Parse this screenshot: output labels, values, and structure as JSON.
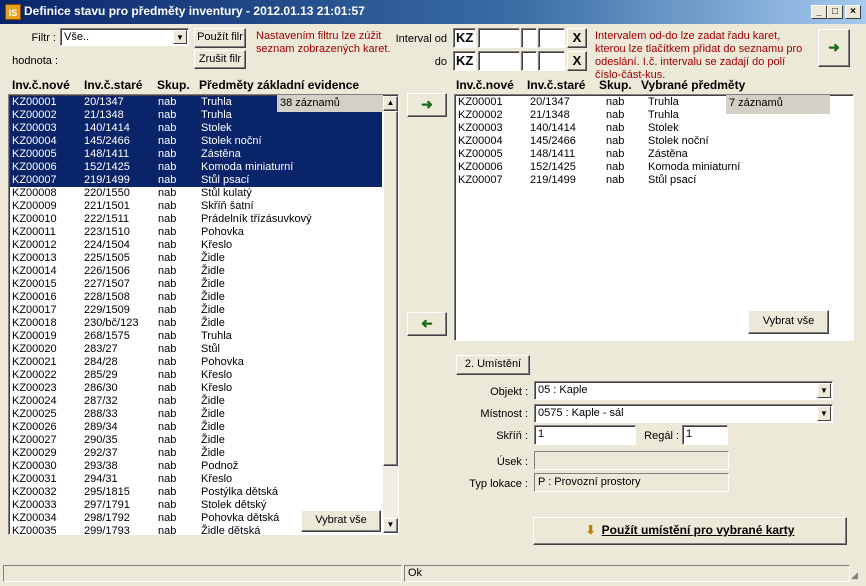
{
  "window": {
    "title": "Definice stavu pro předměty inventury - 2012.01.13 21:01:57",
    "app_icon": "IS"
  },
  "filter": {
    "filter_label": "Filtr :",
    "filter_value": "Vše..",
    "hodnota_label": "hodnota :",
    "apply_label": "Použít filr",
    "cancel_label": "Zrušit filr",
    "note": "Nastavením filtru lze zúžit seznam zobrazených karet."
  },
  "interval": {
    "from_label": "Interval od",
    "to_label": "do",
    "prefix_from": "KZ",
    "prefix_to": "KZ",
    "clear_symbol": "X",
    "note": "Intervalem od-do lze zadat řadu karet, kterou lze tlačítkem přidat do seznamu pro odeslání. I.č. intervalu se zadají do polí číslo-část-kus."
  },
  "left_list": {
    "headers": [
      "Inv.č.nové",
      "Inv.č.staré",
      "Skup.",
      "Předměty základní evidence"
    ],
    "count_label": "38 záznamů",
    "select_all_label": "Vybrat vše",
    "rows": [
      {
        "new": "KZ00001",
        "old": "20/1347",
        "grp": "nab",
        "name": "Truhla",
        "sel": true
      },
      {
        "new": "KZ00002",
        "old": "21/1348",
        "grp": "nab",
        "name": "Truhla",
        "sel": true
      },
      {
        "new": "KZ00003",
        "old": "140/1414",
        "grp": "nab",
        "name": "Stolek",
        "sel": true
      },
      {
        "new": "KZ00004",
        "old": "145/2466",
        "grp": "nab",
        "name": "Stolek noční",
        "sel": true
      },
      {
        "new": "KZ00005",
        "old": "148/1411",
        "grp": "nab",
        "name": "Zástěna",
        "sel": true
      },
      {
        "new": "KZ00006",
        "old": "152/1425",
        "grp": "nab",
        "name": "Komoda miniaturní",
        "sel": true
      },
      {
        "new": "KZ00007",
        "old": "219/1499",
        "grp": "nab",
        "name": "Stůl psací",
        "sel": true
      },
      {
        "new": "KZ00008",
        "old": "220/1550",
        "grp": "nab",
        "name": "Stůl kulatý",
        "sel": false
      },
      {
        "new": "KZ00009",
        "old": "221/1501",
        "grp": "nab",
        "name": "Skříň šatní",
        "sel": false
      },
      {
        "new": "KZ00010",
        "old": "222/1511",
        "grp": "nab",
        "name": "Prádelník třízásuvkový",
        "sel": false
      },
      {
        "new": "KZ00011",
        "old": "223/1510",
        "grp": "nab",
        "name": "Pohovka",
        "sel": false
      },
      {
        "new": "KZ00012",
        "old": "224/1504",
        "grp": "nab",
        "name": "Křeslo",
        "sel": false
      },
      {
        "new": "KZ00013",
        "old": "225/1505",
        "grp": "nab",
        "name": "Židle",
        "sel": false
      },
      {
        "new": "KZ00014",
        "old": "226/1506",
        "grp": "nab",
        "name": "Židle",
        "sel": false
      },
      {
        "new": "KZ00015",
        "old": "227/1507",
        "grp": "nab",
        "name": "Židle",
        "sel": false
      },
      {
        "new": "KZ00016",
        "old": "228/1508",
        "grp": "nab",
        "name": "Židle",
        "sel": false
      },
      {
        "new": "KZ00017",
        "old": "229/1509",
        "grp": "nab",
        "name": "Židle",
        "sel": false
      },
      {
        "new": "KZ00018",
        "old": "230/bč/123",
        "grp": "nab",
        "name": "Židle",
        "sel": false
      },
      {
        "new": "KZ00019",
        "old": "268/1575",
        "grp": "nab",
        "name": "Truhla",
        "sel": false
      },
      {
        "new": "KZ00020",
        "old": "283/27",
        "grp": "nab",
        "name": "Stůl",
        "sel": false
      },
      {
        "new": "KZ00021",
        "old": "284/28",
        "grp": "nab",
        "name": "Pohovka",
        "sel": false
      },
      {
        "new": "KZ00022",
        "old": "285/29",
        "grp": "nab",
        "name": "Křeslo",
        "sel": false
      },
      {
        "new": "KZ00023",
        "old": "286/30",
        "grp": "nab",
        "name": "Křeslo",
        "sel": false
      },
      {
        "new": "KZ00024",
        "old": "287/32",
        "grp": "nab",
        "name": "Židle",
        "sel": false
      },
      {
        "new": "KZ00025",
        "old": "288/33",
        "grp": "nab",
        "name": "Židle",
        "sel": false
      },
      {
        "new": "KZ00026",
        "old": "289/34",
        "grp": "nab",
        "name": "Židle",
        "sel": false
      },
      {
        "new": "KZ00027",
        "old": "290/35",
        "grp": "nab",
        "name": "Židle",
        "sel": false
      },
      {
        "new": "KZ00029",
        "old": "292/37",
        "grp": "nab",
        "name": "Židle",
        "sel": false
      },
      {
        "new": "KZ00030",
        "old": "293/38",
        "grp": "nab",
        "name": "Podnož",
        "sel": false
      },
      {
        "new": "KZ00031",
        "old": "294/31",
        "grp": "nab",
        "name": "Křeslo",
        "sel": false
      },
      {
        "new": "KZ00032",
        "old": "295/1815",
        "grp": "nab",
        "name": "Postýlka dětská",
        "sel": false
      },
      {
        "new": "KZ00033",
        "old": "297/1791",
        "grp": "nab",
        "name": "Stolek dětský",
        "sel": false
      },
      {
        "new": "KZ00034",
        "old": "298/1792",
        "grp": "nab",
        "name": "Pohovka dětská",
        "sel": false
      },
      {
        "new": "KZ00035",
        "old": "299/1793",
        "grp": "nab",
        "name": "Židle dětská",
        "sel": false
      }
    ]
  },
  "right_list": {
    "headers": [
      "Inv.č.nové",
      "Inv.č.staré",
      "Skup.",
      "Vybrané předměty"
    ],
    "count_label": "7 záznamů",
    "select_all_label": "Vybrat vše",
    "rows": [
      {
        "new": "KZ00001",
        "old": "20/1347",
        "grp": "nab",
        "name": "Truhla"
      },
      {
        "new": "KZ00002",
        "old": "21/1348",
        "grp": "nab",
        "name": "Truhla"
      },
      {
        "new": "KZ00003",
        "old": "140/1414",
        "grp": "nab",
        "name": "Stolek"
      },
      {
        "new": "KZ00004",
        "old": "145/2466",
        "grp": "nab",
        "name": "Stolek noční"
      },
      {
        "new": "KZ00005",
        "old": "148/1411",
        "grp": "nab",
        "name": "Zástěna"
      },
      {
        "new": "KZ00006",
        "old": "152/1425",
        "grp": "nab",
        "name": "Komoda miniaturní"
      },
      {
        "new": "KZ00007",
        "old": "219/1499",
        "grp": "nab",
        "name": "Stůl psací"
      }
    ]
  },
  "location": {
    "tab_label": "2. Umístění",
    "objekt_label": "Objekt :",
    "objekt_value": "05 : Kaple",
    "mistnost_label": "Místnost :",
    "mistnost_value": "0575 : Kaple - sál",
    "skrin_label": "Skříň :",
    "skrin_value": "1",
    "regal_label": "Regál :",
    "regal_value": "1",
    "usek_label": "Úsek :",
    "usek_value": "",
    "typ_label": "Typ lokace :",
    "typ_value": "P : Provozní prostory",
    "apply_button": "Použít umístění pro vybrané karty"
  },
  "status": {
    "text": "Ok"
  },
  "colors": {
    "selection": "#0A246A",
    "note_red": "#A00000",
    "face": "#ECE9D8"
  }
}
